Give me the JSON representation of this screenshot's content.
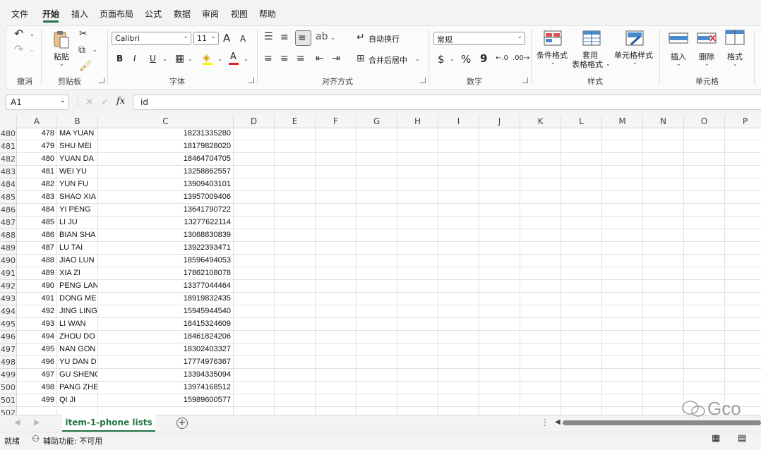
{
  "menu": [
    "文件",
    "开始",
    "插入",
    "页面布局",
    "公式",
    "数据",
    "审阅",
    "视图",
    "帮助"
  ],
  "ribbon": {
    "undo_group": "撤消",
    "clipboard": {
      "paste": "粘贴",
      "group": "剪贴板"
    },
    "font": {
      "name": "Calibri",
      "size": "11",
      "group": "字体",
      "bold": "B",
      "italic": "I",
      "underline": "U",
      "grow": "A",
      "shrink": "A",
      "font_color_letter": "A"
    },
    "alignment": {
      "wrap": "自动换行",
      "merge": "合并后居中",
      "group": "对齐方式"
    },
    "number": {
      "format": "常规",
      "group": "数字",
      "currency": "$",
      "percent": "%",
      "comma": "9"
    },
    "styles": {
      "conditional": "条件格式",
      "table_line1": "套用",
      "table_line2": "表格格式",
      "cell_styles": "单元格样式",
      "group": "样式"
    },
    "cells": {
      "insert": "插入",
      "delete": "删除",
      "format": "格式",
      "group": "单元格"
    }
  },
  "formula_bar": {
    "name_box": "A1",
    "fx": "fx",
    "value": "id"
  },
  "columns": [
    "A",
    "B",
    "C",
    "D",
    "E",
    "F",
    "G",
    "H",
    "I",
    "J",
    "K",
    "L",
    "M",
    "N",
    "O",
    "P"
  ],
  "rows": [
    {
      "r": "480",
      "a": "478",
      "b": "MA YUAN",
      "c": "18231335280"
    },
    {
      "r": "481",
      "a": "479",
      "b": "SHU MEI",
      "c": "18179828020"
    },
    {
      "r": "482",
      "a": "480",
      "b": "YUAN DA",
      "c": "18464704705"
    },
    {
      "r": "483",
      "a": "481",
      "b": "WEI YU",
      "c": "13258862557"
    },
    {
      "r": "484",
      "a": "482",
      "b": "YUN FU",
      "c": "13909403101"
    },
    {
      "r": "485",
      "a": "483",
      "b": "SHAO XIA",
      "c": "13957009406"
    },
    {
      "r": "486",
      "a": "484",
      "b": "YI PENG",
      "c": "13641790722"
    },
    {
      "r": "487",
      "a": "485",
      "b": "LI JU",
      "c": "13277622114"
    },
    {
      "r": "488",
      "a": "486",
      "b": "BIAN SHA",
      "c": "13068830839"
    },
    {
      "r": "489",
      "a": "487",
      "b": "LU TAI",
      "c": "13922393471"
    },
    {
      "r": "490",
      "a": "488",
      "b": "JIAO LUN",
      "c": "18596494053"
    },
    {
      "r": "491",
      "a": "489",
      "b": "XIA ZI",
      "c": "17862108078"
    },
    {
      "r": "492",
      "a": "490",
      "b": "PENG LAN",
      "c": "13377044464"
    },
    {
      "r": "493",
      "a": "491",
      "b": "DONG ME",
      "c": "18919832435"
    },
    {
      "r": "494",
      "a": "492",
      "b": "JING LING",
      "c": "15945944540"
    },
    {
      "r": "495",
      "a": "493",
      "b": "LI WAN",
      "c": "18415324609"
    },
    {
      "r": "496",
      "a": "494",
      "b": "ZHOU DO",
      "c": "18461824206"
    },
    {
      "r": "497",
      "a": "495",
      "b": "NAN GON",
      "c": "18302403327"
    },
    {
      "r": "498",
      "a": "496",
      "b": "YU DAN D",
      "c": "17774976367"
    },
    {
      "r": "499",
      "a": "497",
      "b": "GU SHENG",
      "c": "13394335094"
    },
    {
      "r": "500",
      "a": "498",
      "b": "PANG ZHE",
      "c": "13974168512"
    },
    {
      "r": "501",
      "a": "499",
      "b": "QI JI",
      "c": "15989600577"
    },
    {
      "r": "502",
      "a": "",
      "b": "",
      "c": ""
    }
  ],
  "sheet_tab": "item-1-phone lists",
  "status": {
    "ready": "就绪",
    "accessibility": "辅助功能: 不可用"
  },
  "watermark": "Gco",
  "colors": {
    "accent": "#217346"
  }
}
